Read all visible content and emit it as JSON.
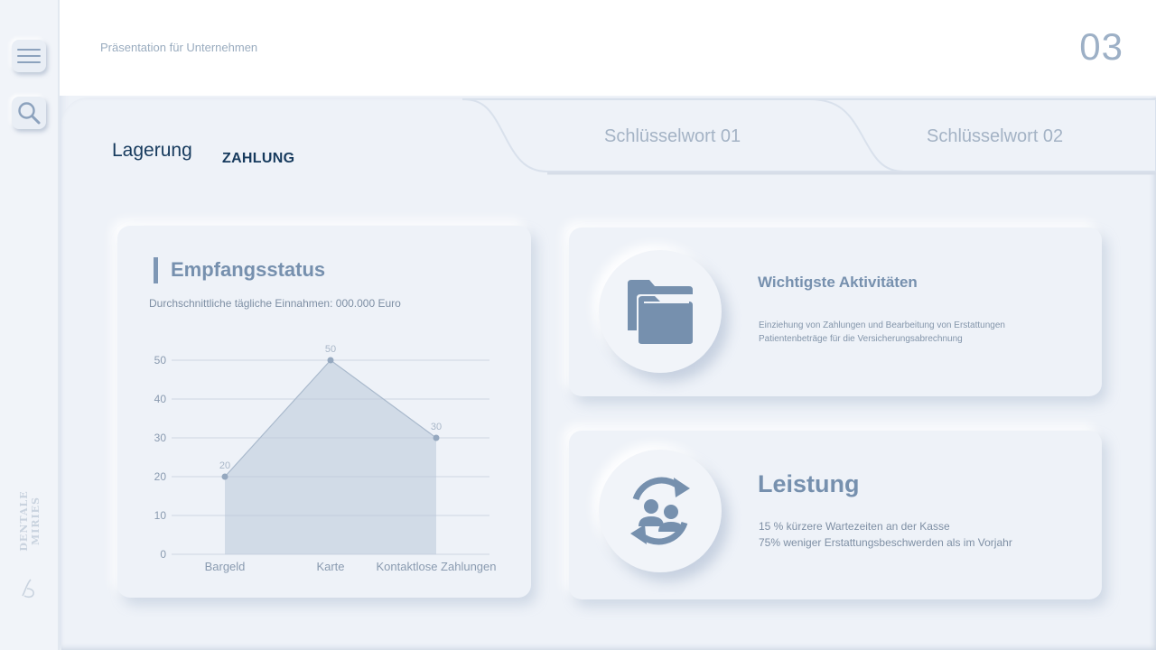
{
  "header": {
    "subtitle": "Präsentation für Unternehmen",
    "page_number": "03"
  },
  "sidebar": {
    "brand": "DENTALE MIRIES",
    "menu_icon": "hamburger-icon",
    "search_icon": "search-icon"
  },
  "tabs": {
    "active_title": "Lagerung",
    "active_subtitle": "ZAHLUNG",
    "items": [
      {
        "label": "Schlüsselwort 01"
      },
      {
        "label": "Schlüsselwort 02"
      }
    ]
  },
  "chart_card": {
    "title": "Empfangsstatus",
    "subtitle": "Durchschnittliche tägliche Einnahmen: 000.000 Euro"
  },
  "chart_data": {
    "type": "area",
    "categories": [
      "Bargeld",
      "Karte",
      "Kontaktlose Zahlungen"
    ],
    "values": [
      20,
      50,
      30
    ],
    "data_labels": [
      "20",
      "50",
      "30"
    ],
    "ylim": [
      0,
      50
    ],
    "yticks": [
      "0",
      "10",
      "20",
      "30",
      "40",
      "50"
    ],
    "grid": true,
    "color": "#b9c8d8"
  },
  "activities": {
    "title": "Wichtigste Aktivitäten",
    "lines": [
      "Einziehung von Zahlungen und Bearbeitung von Erstattungen",
      "Patientenbeträge für die Versicherungsabrechnung"
    ],
    "icon": "folder-icon"
  },
  "performance": {
    "title": "Leistung",
    "lines": [
      "15 % kürzere Wartezeiten an der Kasse",
      "75% weniger Erstattungsbeschwerden als im Vorjahr"
    ],
    "icon": "user-sync-icon"
  },
  "colors": {
    "accent": "#7690ae",
    "dark_text": "#163a5d",
    "background": "#eef2f8"
  }
}
